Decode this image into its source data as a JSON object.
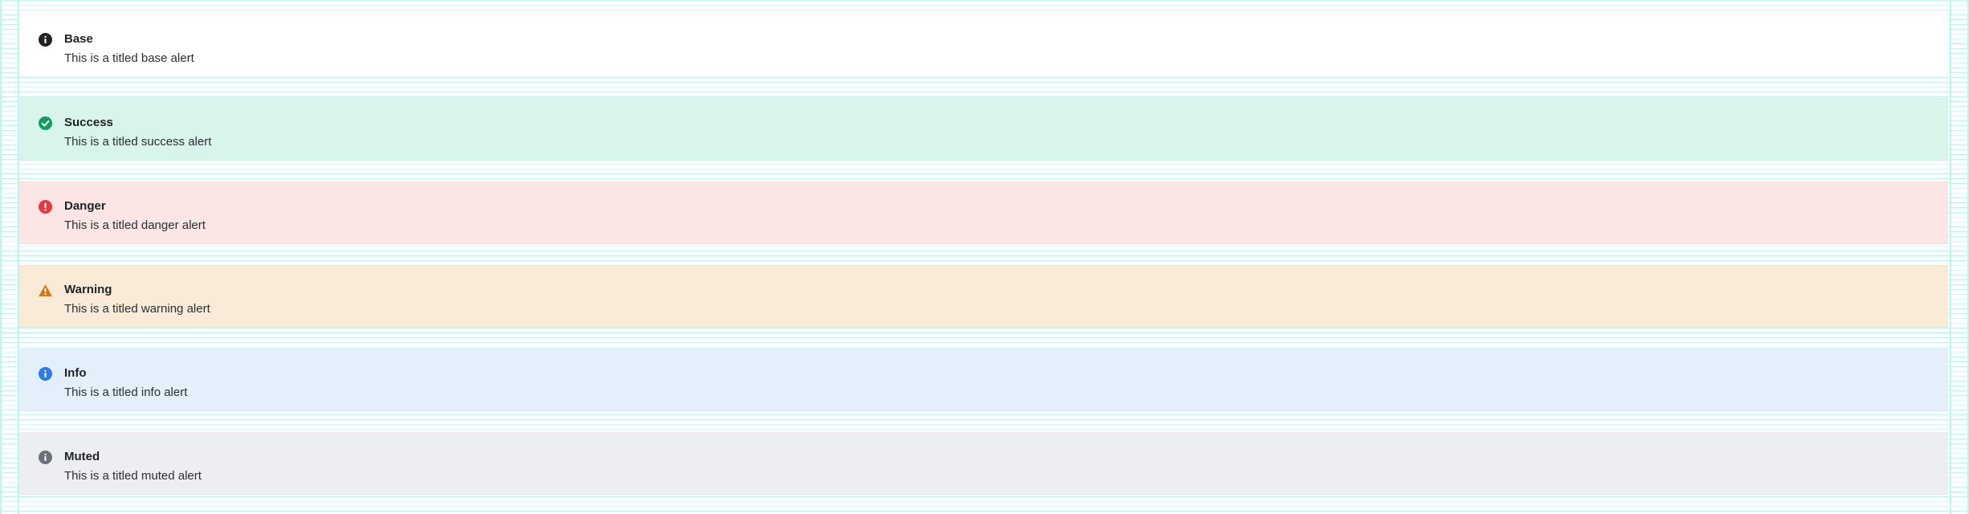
{
  "alerts": [
    {
      "id": "base",
      "title": "Base",
      "message": "This is a titled base alert",
      "icon": "info-icon",
      "background": "#ffffff",
      "icon_color": "#1f2328"
    },
    {
      "id": "success",
      "title": "Success",
      "message": "This is a titled success alert",
      "icon": "check-circle-icon",
      "background": "#d9f4ea",
      "icon_color": "#0f9d63"
    },
    {
      "id": "danger",
      "title": "Danger",
      "message": "This is a titled danger alert",
      "icon": "exclamation-circle-icon",
      "background": "#fbe5e5",
      "icon_color": "#e5383f"
    },
    {
      "id": "warning",
      "title": "Warning",
      "message": "This is a titled warning alert",
      "icon": "warning-triangle-icon",
      "background": "#faebd9",
      "icon_color": "#d87514"
    },
    {
      "id": "info",
      "title": "Info",
      "message": "This is a titled info alert",
      "icon": "info-icon",
      "background": "#e4effc",
      "icon_color": "#2d7be5"
    },
    {
      "id": "muted",
      "title": "Muted",
      "message": "This is a titled muted alert",
      "icon": "info-icon",
      "background": "#eceef1",
      "icon_color": "#6b7079"
    }
  ]
}
